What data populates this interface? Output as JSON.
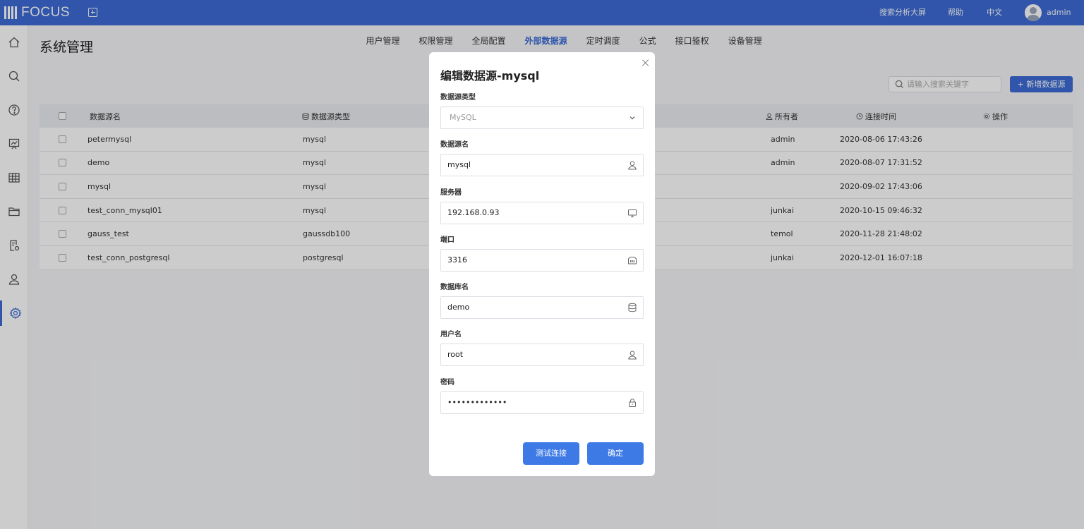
{
  "app": {
    "logo_text": "FOCUS",
    "top_links": [
      "搜索分析大屏",
      "帮助",
      "中文"
    ],
    "user": "admin"
  },
  "page": {
    "title": "系统管理",
    "tabs": [
      "用户管理",
      "权限管理",
      "全局配置",
      "外部数据源",
      "定时调度",
      "公式",
      "接口鉴权",
      "设备管理"
    ],
    "active_tab": "外部数据源"
  },
  "toolbar": {
    "search_placeholder": "请输入搜索关键字",
    "add_label": "+ 新增数据源"
  },
  "table": {
    "headers": {
      "name": "数据源名",
      "type": "数据源类型",
      "owner": "所有者",
      "time": "连接时间",
      "action": "操作"
    },
    "rows": [
      {
        "name": "petermysql",
        "type": "mysql",
        "owner": "admin",
        "time": "2020-08-06 17:43:26"
      },
      {
        "name": "demo",
        "type": "mysql",
        "owner": "admin",
        "time": "2020-08-07 17:31:52"
      },
      {
        "name": "mysql",
        "type": "mysql",
        "owner": "",
        "time": "2020-09-02 17:43:06"
      },
      {
        "name": "test_conn_mysql01",
        "type": "mysql",
        "owner": "junkai",
        "time": "2020-10-15 09:46:32"
      },
      {
        "name": "gauss_test",
        "type": "gaussdb100",
        "owner": "temol",
        "time": "2020-11-28 21:48:02"
      },
      {
        "name": "test_conn_postgresql",
        "type": "postgresql",
        "owner": "junkai",
        "time": "2020-12-01 16:07:18"
      }
    ]
  },
  "modal": {
    "title": "编辑数据源-mysql",
    "fields": {
      "type": {
        "label": "数据源类型",
        "value": "MySQL",
        "icon": "chevron-down-icon"
      },
      "name": {
        "label": "数据源名",
        "value": "mysql",
        "icon": "user-icon"
      },
      "server": {
        "label": "服务器",
        "value": "192.168.0.93",
        "icon": "monitor-icon"
      },
      "port": {
        "label": "端口",
        "value": "3316",
        "icon": "port-icon"
      },
      "database": {
        "label": "数据库名",
        "value": "demo",
        "icon": "database-icon"
      },
      "username": {
        "label": "用户名",
        "value": "root",
        "icon": "user-icon"
      },
      "password": {
        "label": "密码",
        "value": "•••••••••••••",
        "icon": "lock-icon"
      }
    },
    "test_label": "测试连接",
    "confirm_label": "确定"
  },
  "colors": {
    "brand": "#3c6bd6",
    "button": "#3d7ae6"
  }
}
